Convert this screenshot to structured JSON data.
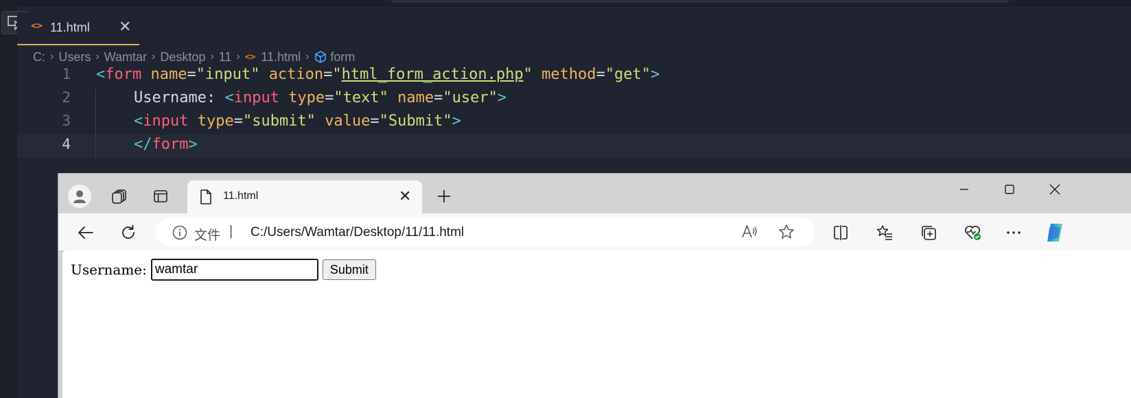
{
  "editor": {
    "tab_icon": "html-file-icon",
    "tab_label": "11.html",
    "tab_close": "✕",
    "breadcrumb": {
      "parts": [
        "C:",
        "Users",
        "Wamtar",
        "Desktop",
        "11"
      ],
      "file": "11.html",
      "symbol": "form"
    },
    "line_numbers": [
      "1",
      "2",
      "3",
      "4"
    ],
    "code": {
      "l1": [
        "<",
        "form",
        " ",
        "name",
        "=",
        "\"input\"",
        " ",
        "action",
        "=",
        "\"",
        "html_form_action.php",
        "\"",
        " ",
        "method",
        "=",
        "\"get\"",
        ">"
      ],
      "l2": [
        "Username: ",
        "<",
        "input",
        " ",
        "type",
        "=",
        "\"text\"",
        " ",
        "name",
        "=",
        "\"user\"",
        ">"
      ],
      "l3": [
        "<",
        "input",
        " ",
        "type",
        "=",
        "\"submit\"",
        " ",
        "value",
        "=",
        "\"Submit\"",
        ">"
      ],
      "l4": [
        "</",
        "form",
        ">"
      ]
    }
  },
  "browser": {
    "tab_label": "11.html",
    "tab_close": "✕",
    "new_tab": "+",
    "address_label": "文件",
    "address_sep": "|",
    "url": "C:/Users/Wamtar/Desktop/11/11.html",
    "page": {
      "username_label": "Username:",
      "username_value": "wamtar",
      "submit_label": "Submit"
    }
  },
  "colors": {
    "editor_bg": "#1f2430",
    "tag": "#ff5f7a",
    "attr": "#f0b55a",
    "string": "#c8e07a",
    "bracket": "#5ec5d0",
    "browser_chrome": "#d3d3d3",
    "accent_tab": "#e0b050"
  }
}
